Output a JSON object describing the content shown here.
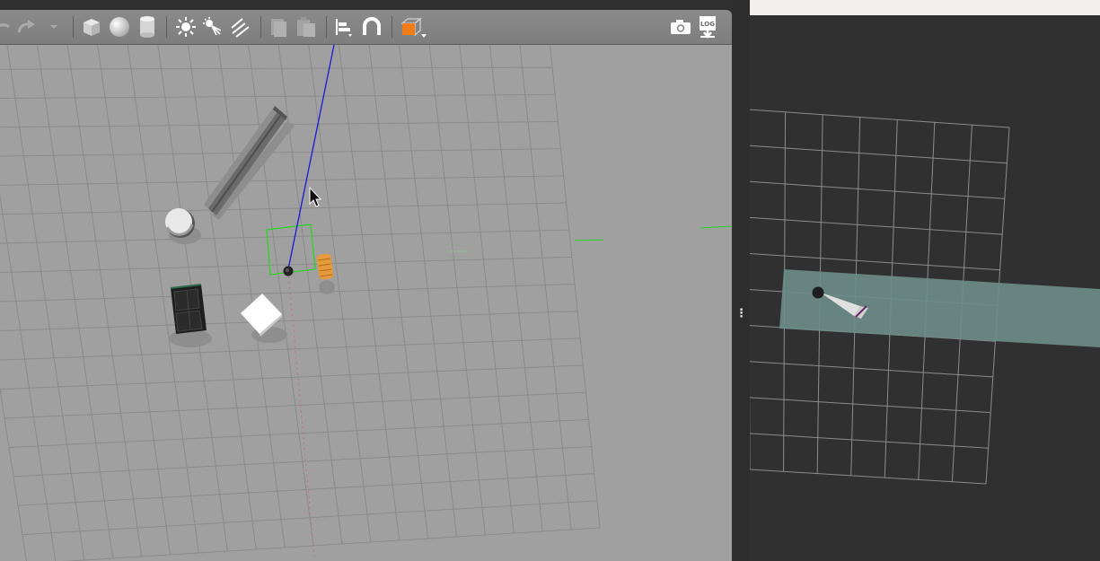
{
  "toolbar": {
    "items": [
      {
        "name": "undo-button",
        "icon": "undo-icon"
      },
      {
        "name": "redo-button",
        "icon": "redo-icon"
      },
      {
        "name": "redo-history-dropdown",
        "icon": "chevron-down-icon"
      },
      {
        "name": "box-shape-button",
        "icon": "box-icon"
      },
      {
        "name": "sphere-shape-button",
        "icon": "sphere-icon"
      },
      {
        "name": "cylinder-shape-button",
        "icon": "cylinder-icon"
      },
      {
        "name": "point-light-button",
        "icon": "point-light-icon"
      },
      {
        "name": "spot-light-button",
        "icon": "spot-light-icon"
      },
      {
        "name": "directional-light-button",
        "icon": "directional-light-icon"
      },
      {
        "name": "copy-button",
        "icon": "copy-icon"
      },
      {
        "name": "paste-button",
        "icon": "paste-icon"
      },
      {
        "name": "align-button",
        "icon": "align-icon"
      },
      {
        "name": "snap-button",
        "icon": "magnet-icon"
      },
      {
        "name": "view-angle-button",
        "icon": "view-cube-icon"
      },
      {
        "name": "screenshot-button",
        "icon": "camera-icon"
      },
      {
        "name": "log-button",
        "icon": "log-icon",
        "label": "LOG"
      }
    ],
    "accent_color": "#f07d18"
  },
  "scene": {
    "background": "#a0a0a0",
    "grid_color": "#8a8a8a",
    "selection_color": "#27d41f",
    "axis_z_color": "#1a1ad8",
    "axis_x_color": "#c0707a",
    "objects": [
      {
        "name": "beam-model",
        "color": "#6b6b6b"
      },
      {
        "name": "cylinder-model",
        "color": "#e8e8e8"
      },
      {
        "name": "robot-model",
        "color": "#222222"
      },
      {
        "name": "cabinet-model",
        "color": "#1e1e1e"
      },
      {
        "name": "cube-model",
        "color": "#ffffff"
      },
      {
        "name": "barrel-model",
        "color": "#e59a3c"
      }
    ]
  },
  "map_view": {
    "background": "#303030",
    "grid_color": "#8c8c8c",
    "laser_band_color": "#6d8c88",
    "robot_color": "#1e1e1e",
    "sensor_cone_color": "#e0e0e0"
  },
  "splitter_handle": "⋮"
}
